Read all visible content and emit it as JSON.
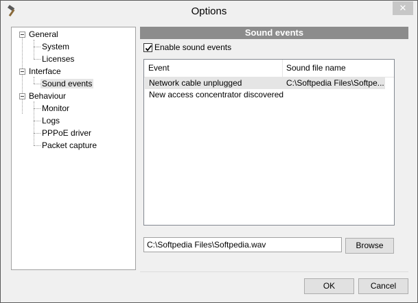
{
  "window": {
    "title": "Options",
    "close_glyph": "✕",
    "icon": "hammer-icon"
  },
  "tree": {
    "items": [
      {
        "label": "General",
        "level": 0,
        "expanded": true
      },
      {
        "label": "System",
        "level": 1
      },
      {
        "label": "Licenses",
        "level": 1
      },
      {
        "label": "Interface",
        "level": 0,
        "expanded": true
      },
      {
        "label": "Sound events",
        "level": 1,
        "selected": true
      },
      {
        "label": "Behaviour",
        "level": 0,
        "expanded": true
      },
      {
        "label": "Monitor",
        "level": 1
      },
      {
        "label": "Logs",
        "level": 1
      },
      {
        "label": "PPPoE driver",
        "level": 1
      },
      {
        "label": "Packet capture",
        "level": 1
      }
    ]
  },
  "panel": {
    "header": "Sound events",
    "enable_label": "Enable sound events",
    "enable_checked": true,
    "columns": [
      "Event",
      "Sound file name"
    ],
    "rows": [
      {
        "event": "Network cable unplugged",
        "file": "C:\\Softpedia Files\\Softpe...",
        "selected": true
      },
      {
        "event": "New access concentrator discovered",
        "file": ""
      }
    ],
    "file_path": "C:\\Softpedia Files\\Softpedia.wav",
    "browse_label": "Browse"
  },
  "footer": {
    "ok_label": "OK",
    "cancel_label": "Cancel"
  },
  "colors": {
    "header_bg": "#8c8c8c",
    "selection": "#e5e5e5"
  }
}
